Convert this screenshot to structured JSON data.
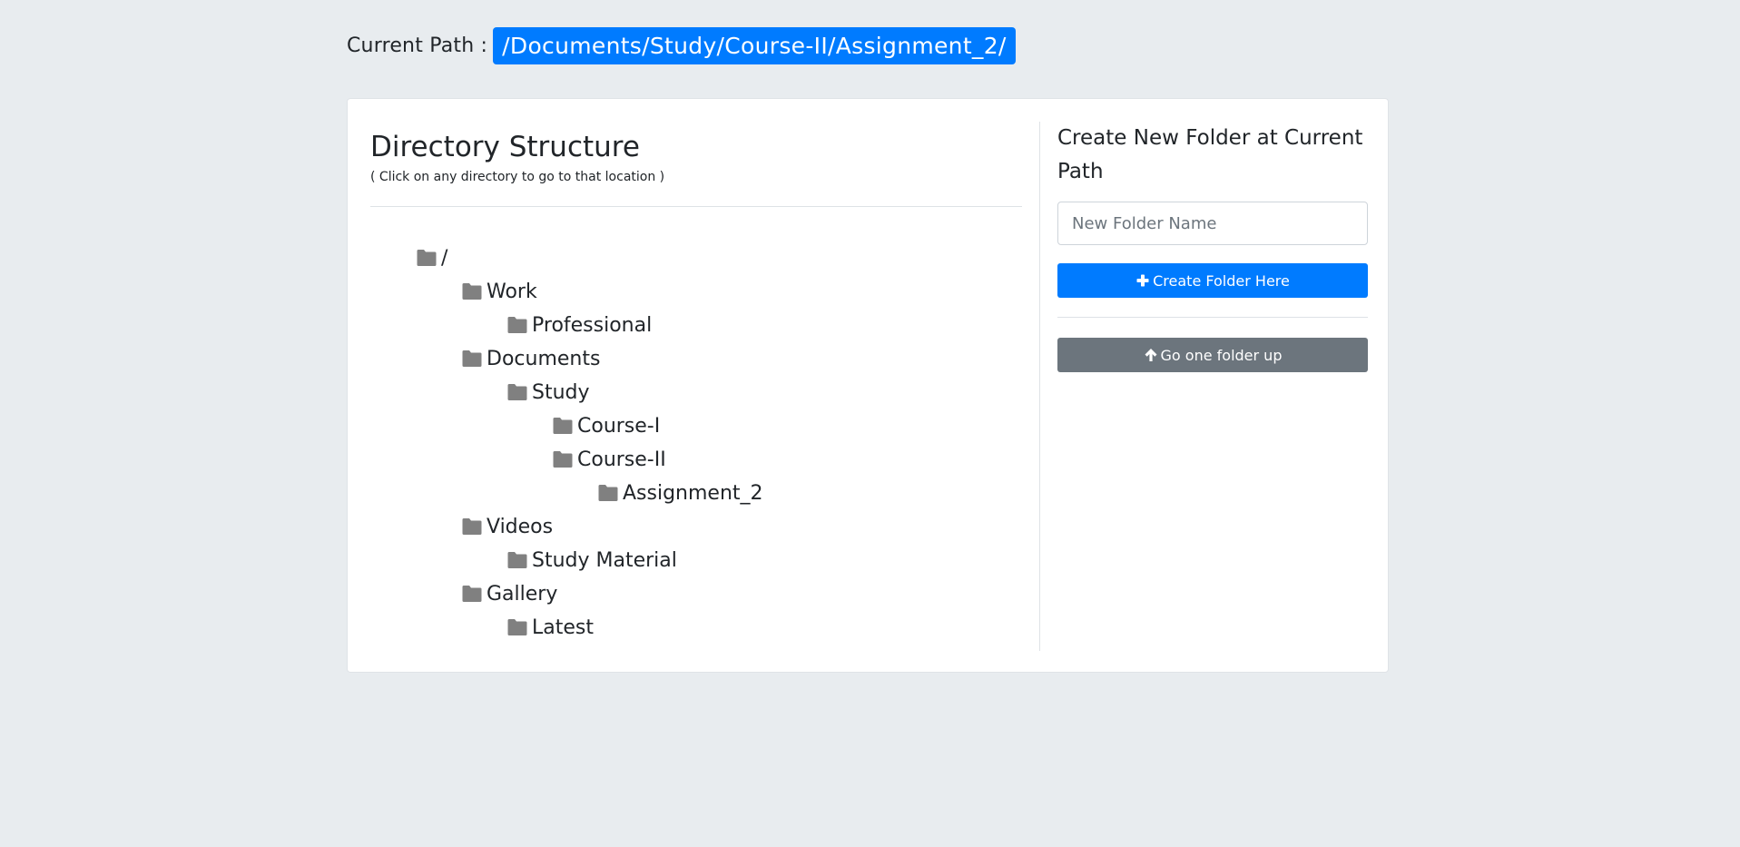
{
  "path": {
    "label": "Current Path :",
    "value": "/Documents/Study/Course-II/Assignment_2/",
    "badge_color": "#007bff"
  },
  "directory": {
    "title": "Directory Structure",
    "subtitle": "( Click on any directory to go to that location )",
    "tree": [
      {
        "label": "/",
        "depth": 0,
        "icon": "folder-icon"
      },
      {
        "label": "Work",
        "depth": 1,
        "icon": "folder-icon"
      },
      {
        "label": "Professional",
        "depth": 2,
        "icon": "folder-icon"
      },
      {
        "label": "Documents",
        "depth": 1,
        "icon": "folder-icon"
      },
      {
        "label": "Study",
        "depth": 2,
        "icon": "folder-icon"
      },
      {
        "label": "Course-I",
        "depth": 3,
        "icon": "folder-icon"
      },
      {
        "label": "Course-II",
        "depth": 3,
        "icon": "folder-icon"
      },
      {
        "label": "Assignment_2",
        "depth": 4,
        "icon": "folder-icon"
      },
      {
        "label": "Videos",
        "depth": 1,
        "icon": "folder-icon"
      },
      {
        "label": "Study Material",
        "depth": 2,
        "icon": "folder-icon"
      },
      {
        "label": "Gallery",
        "depth": 1,
        "icon": "folder-icon"
      },
      {
        "label": "Latest",
        "depth": 2,
        "icon": "folder-icon"
      }
    ]
  },
  "create_panel": {
    "title": "Create New Folder at Current Path",
    "input_placeholder": "New Folder Name",
    "input_value": "",
    "create_button": {
      "label": "Create Folder Here",
      "icon": "plus-icon",
      "color": "#007bff"
    },
    "up_button": {
      "label": "Go one folder up",
      "icon": "arrow-up-icon",
      "color": "#6c757d"
    }
  },
  "colors": {
    "background": "#e8ecef",
    "folder_icon": "#808080"
  }
}
